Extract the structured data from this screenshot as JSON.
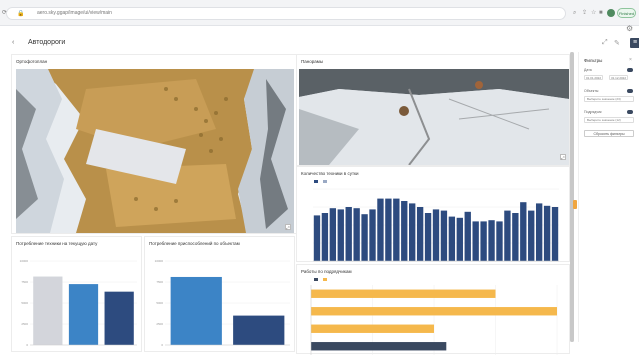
{
  "browser": {
    "url": "aero.sky.ggap/image/ui/view/main",
    "badge": "Finished"
  },
  "header": {
    "title": "Автодороги"
  },
  "panels": {
    "ortho_title": "Ортофотоплан",
    "panorama_title": "Панорамы",
    "bar1_title": "Потребление техники на текущую дату",
    "bar2_title": "Потребление приспособлений по объектам",
    "vbar_title": "Количество техники в сутки",
    "hbar_title": "Работы по подрядчикам"
  },
  "filter_panel": {
    "title": "Фильтры",
    "date_label": "Дата",
    "date_from": "01.01.2022",
    "date_to": "31.12.2022",
    "object_label": "Объекты",
    "object_value": "Выберите значение (23)",
    "contractor_label": "Подрядчик",
    "contractor_value": "Выберите значение (12)",
    "reset_label": "Сбросить фильтры"
  },
  "chart_data": [
    {
      "type": "bar",
      "categories": [
        "",
        "",
        ""
      ],
      "values": [
        8150,
        7250,
        6350
      ],
      "colors": [
        "#d3d5db",
        "#3c84c6",
        "#2d4b7f"
      ],
      "ylim": [
        0,
        10000
      ],
      "yticks": [
        "10000",
        "7500",
        "5000",
        "2500",
        "0"
      ],
      "value_labels": [
        "",
        "",
        ""
      ]
    },
    {
      "type": "bar",
      "categories": [
        "",
        ""
      ],
      "values": [
        8100,
        3500
      ],
      "colors": [
        "#3c84c6",
        "#2d4b7f"
      ],
      "ylim": [
        0,
        10000
      ],
      "yticks": [
        "10000",
        "7500",
        "5000",
        "2500",
        "0"
      ],
      "value_labels": [
        "",
        ""
      ]
    },
    {
      "type": "bar",
      "categories": [
        "",
        "",
        "",
        "",
        "",
        "",
        "",
        "",
        "",
        "",
        "",
        "",
        "",
        "",
        "",
        "",
        "",
        "",
        "",
        "",
        "",
        "",
        "",
        "",
        "",
        "",
        "",
        "",
        "",
        "",
        ""
      ],
      "values": [
        38,
        40,
        44,
        43,
        45,
        44,
        39,
        43,
        52,
        52,
        52,
        50,
        48,
        45,
        40,
        43,
        42,
        37,
        36,
        41,
        33,
        33,
        34,
        33,
        42,
        40,
        49,
        42,
        48,
        46,
        45
      ],
      "ylim": [
        0,
        60
      ],
      "legend": [
        "",
        ""
      ],
      "color": "#2d4b7f"
    },
    {
      "type": "bar",
      "orientation": "horizontal",
      "categories": [
        "",
        "",
        "",
        ""
      ],
      "values": [
        150,
        200,
        100,
        110
      ],
      "colors": [
        "#f5b84c",
        "#f5b84c",
        "#f5b84c",
        "#3a4960"
      ],
      "xlim": [
        0,
        200
      ],
      "legend": [
        "",
        ""
      ]
    }
  ]
}
